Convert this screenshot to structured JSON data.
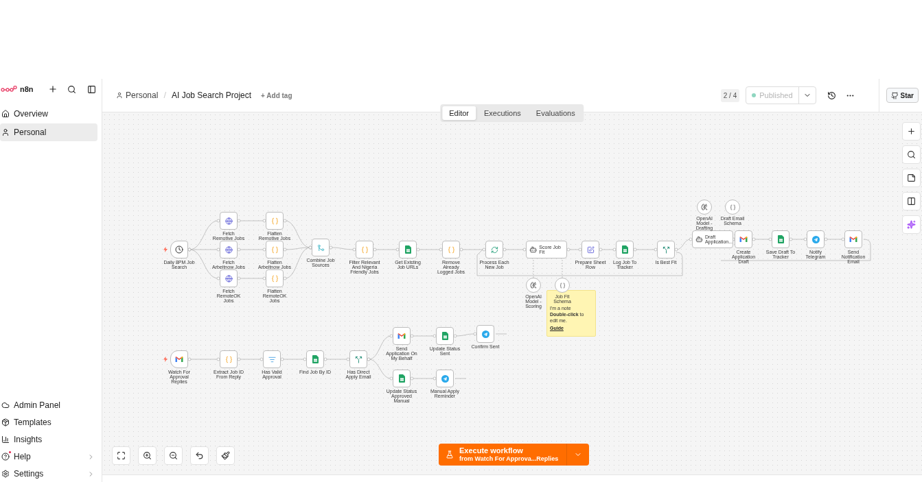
{
  "sidebar": {
    "brand": "n8n",
    "items": [
      {
        "label": "Overview",
        "selected": false
      },
      {
        "label": "Personal",
        "selected": true
      }
    ],
    "bottom_items": [
      {
        "label": "Admin Panel",
        "chevron": false,
        "dot": false
      },
      {
        "label": "Templates",
        "chevron": false,
        "dot": false
      },
      {
        "label": "Insights",
        "chevron": false,
        "dot": false
      },
      {
        "label": "Help",
        "chevron": true,
        "dot": true
      },
      {
        "label": "Settings",
        "chevron": true,
        "dot": false
      }
    ]
  },
  "header": {
    "breadcrumb": "Personal",
    "separator": "/",
    "title": "AI Job Search Project",
    "add_tag": "+ Add tag",
    "version": "2 / 4",
    "publish": {
      "label": "Published",
      "disabled": true
    },
    "star": "Star"
  },
  "tabs": [
    {
      "label": "Editor",
      "selected": true
    },
    {
      "label": "Executions",
      "selected": false
    },
    {
      "label": "Evaluations",
      "selected": false
    }
  ],
  "nodes": [
    {
      "label": "Daily 8PM Job Search",
      "kind": "schedule",
      "trigger": true
    },
    {
      "label": "Fetch Remotive Jobs",
      "kind": "http",
      "trigger": false
    },
    {
      "label": "Fetch Arbeitnow Jobs",
      "kind": "http",
      "trigger": false
    },
    {
      "label": "Fetch RemoteOK Jobs",
      "kind": "http",
      "trigger": false
    },
    {
      "label": "Flatten Remotive Jobs",
      "kind": "code",
      "trigger": false
    },
    {
      "label": "Flatten Arbeitnow Jobs",
      "kind": "code",
      "trigger": false
    },
    {
      "label": "Flatten RemoteOK Jobs",
      "kind": "code",
      "trigger": false
    },
    {
      "label": "Combine Job Sources",
      "kind": "merge",
      "trigger": false
    },
    {
      "label": "Filter Relevant And Nigeria Friendly Jobs",
      "kind": "code",
      "trigger": false
    },
    {
      "label": "Get Existing Job URLs",
      "kind": "sheets",
      "trigger": false
    },
    {
      "label": "Remove Already Logged Jobs",
      "kind": "code",
      "trigger": false
    },
    {
      "label": "Process Each New Job",
      "kind": "loop",
      "trigger": false
    },
    {
      "label": "Score Job Fit",
      "kind": "agent",
      "trigger": false
    },
    {
      "label": "Prepare Sheet Row",
      "kind": "edit",
      "trigger": false
    },
    {
      "label": "Log Job To Tracker",
      "kind": "sheets",
      "trigger": false
    },
    {
      "label": "Is Best Fit",
      "kind": "if",
      "trigger": false
    },
    {
      "label": "Draft Application...",
      "kind": "agent",
      "trigger": false
    },
    {
      "label": "Create Application Draft",
      "kind": "gmail",
      "trigger": false
    },
    {
      "label": "Save Draft To Tracker",
      "kind": "sheets",
      "trigger": false
    },
    {
      "label": "Notify Telegram",
      "kind": "telegram",
      "trigger": false
    },
    {
      "label": "Send Notification Email",
      "kind": "gmail",
      "trigger": false
    },
    {
      "label": "OpenAI Model - Drafting",
      "kind": "model"
    },
    {
      "label": "Draft Email Schema",
      "kind": "schema"
    },
    {
      "label": "OpenAI Model - Scoring",
      "kind": "model"
    },
    {
      "label": "Job Fit Schema",
      "kind": "schema"
    },
    {
      "label": "Watch For Approval Replies",
      "kind": "gmail",
      "trigger": true
    },
    {
      "label": "Extract Job ID From Reply",
      "kind": "code",
      "trigger": false
    },
    {
      "label": "Has Valid Approval",
      "kind": "filter",
      "trigger": false
    },
    {
      "label": "Find Job By ID",
      "kind": "sheets",
      "trigger": false
    },
    {
      "label": "Has Direct Apply Email",
      "kind": "if",
      "trigger": false
    },
    {
      "label": "Send Application On My Behalf",
      "kind": "gmail",
      "trigger": false
    },
    {
      "label": "Update Status Sent",
      "kind": "sheets",
      "trigger": false
    },
    {
      "label": "Confirm Sent",
      "kind": "telegram",
      "trigger": false
    },
    {
      "label": "Update Status Approved Manual",
      "kind": "sheets",
      "trigger": false
    },
    {
      "label": "Manual Apply Reminder",
      "kind": "telegram",
      "trigger": false
    }
  ],
  "sticky_note": {
    "title": "I'm a note",
    "body": "**Double-click** to edit me.",
    "link": "Guide"
  },
  "execute": {
    "label": "Execute workflow",
    "sublabel": "from Watch For Approva...Replies"
  }
}
